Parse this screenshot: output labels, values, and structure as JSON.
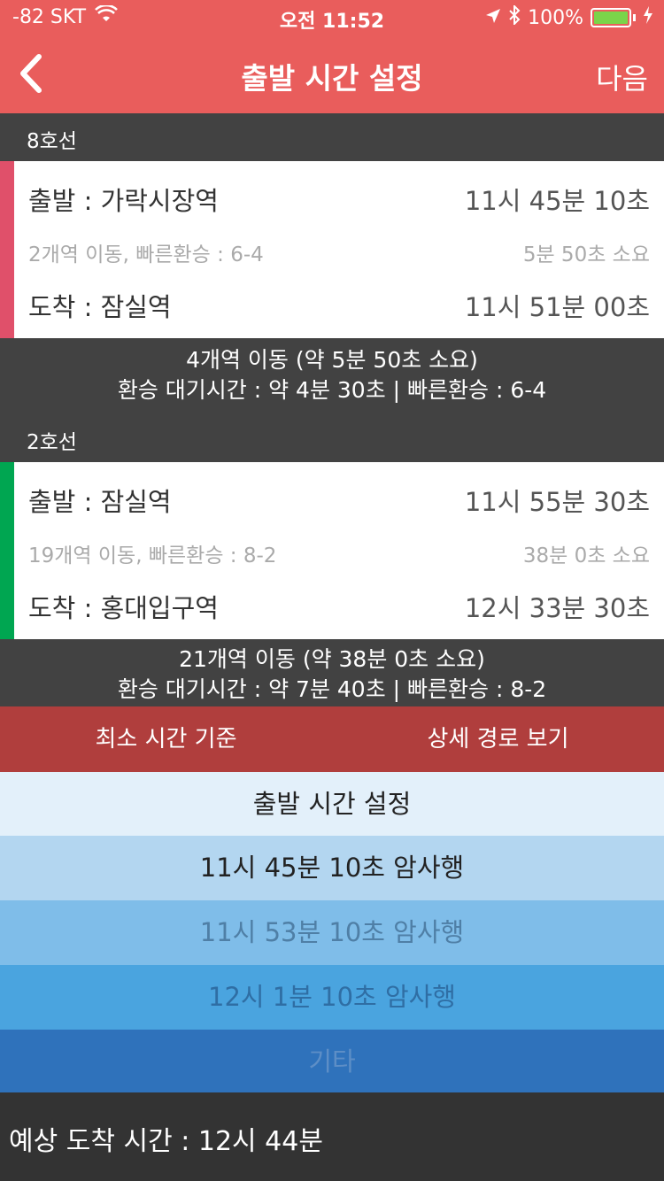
{
  "status_bar": {
    "signal": "-82 SKT",
    "time": "오전 11:52",
    "battery": "100%",
    "battery_level": 1.0
  },
  "nav": {
    "title": "출발 시간 설정",
    "next_label": "다음"
  },
  "segments": [
    {
      "line_name": "8호선",
      "color": "#e0506a",
      "depart_label": "출발 : 가락시장역",
      "depart_time": "11시 45분 10초",
      "info": "2개역 이동, 빠른환승 : 6-4",
      "duration": "5분 50초 소요",
      "arrive_label": "도착 : 잠실역",
      "arrive_time": "11시 51분 00초",
      "summary_line1": "4개역 이동 (약 5분 50초 소요)",
      "summary_line2": "환승 대기시간 : 약 4분 30초 | 빠른환승 : 6-4"
    },
    {
      "line_name": "2호선",
      "color": "#00a651",
      "depart_label": "출발 : 잠실역",
      "depart_time": "11시 55분 30초",
      "info": "19개역 이동, 빠른환승 : 8-2",
      "duration": "38분 0초 소요",
      "arrive_label": "도착 : 홍대입구역",
      "arrive_time": "12시 33분 30초",
      "summary_line1": "21개역 이동 (약 38분 0초 소요)",
      "summary_line2": "환승 대기시간 : 약 7분 40초 | 빠른환승 : 8-2"
    }
  ],
  "actions": {
    "min_time": "최소 시간 기준",
    "detail_route": "상세 경로 보기"
  },
  "picker": {
    "header": "출발 시간 설정",
    "options": [
      "11시 45분 10초 암사행",
      "11시 53분 10초 암사행",
      "12시 1분 10초 암사행",
      "기타"
    ]
  },
  "footer": {
    "eta": "예상 도착 시간 : 12시 44분"
  },
  "colors": {
    "header": "#e95d5c",
    "dark": "#424242",
    "action_bar": "#b03e3d",
    "picker_bg": [
      "#e3f0fa",
      "#b3d6f0",
      "#7fbde9",
      "#4aa4df",
      "#2f72bb"
    ]
  }
}
